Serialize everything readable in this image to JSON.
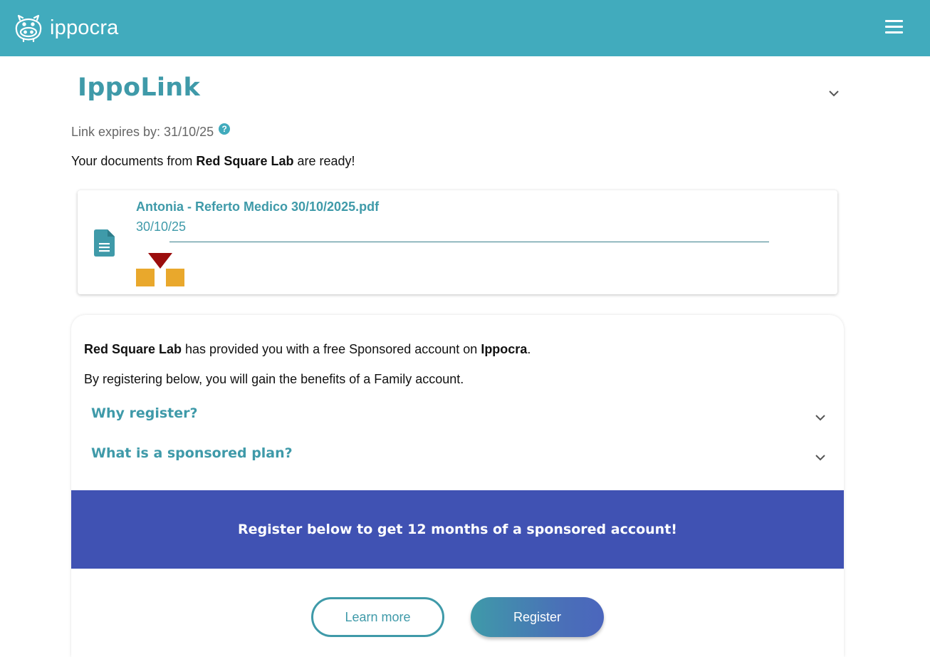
{
  "app": {
    "name": "ippocra"
  },
  "page": {
    "title": "IppoLink"
  },
  "link": {
    "expires_label": "Link expires by: 31/10/25"
  },
  "message": {
    "prefix": "Your documents from ",
    "lab_name": "Red Square Lab",
    "suffix": " are ready!"
  },
  "document": {
    "name": "Antonia - Referto Medico 30/10/2025.pdf",
    "date": "30/10/25"
  },
  "sponsor": {
    "lab_name": "Red Square Lab",
    "line1_middle": " has provided you with a free Sponsored account on ",
    "brand": "Ippocra",
    "line1_end": ".",
    "line2": "By registering below, you will gain the benefits of a Family account.",
    "faq": [
      {
        "question": "Why register?"
      },
      {
        "question": "What is a sponsored plan?"
      }
    ],
    "banner": "Register below to get 12 months of a sponsored account!",
    "learn_more_label": "Learn more",
    "register_label": "Register"
  },
  "colors": {
    "header": "#41abbd",
    "accent": "#3f9aa9",
    "banner": "#4052b3",
    "lab_logo_red": "#9b0d0d",
    "lab_logo_gold": "#e9a82c"
  },
  "icons": {
    "logo": "hippo-logo-icon",
    "menu": "hamburger-menu-icon",
    "help": "question-circle-icon",
    "document": "document-file-icon",
    "chevron": "chevron-down-icon"
  }
}
